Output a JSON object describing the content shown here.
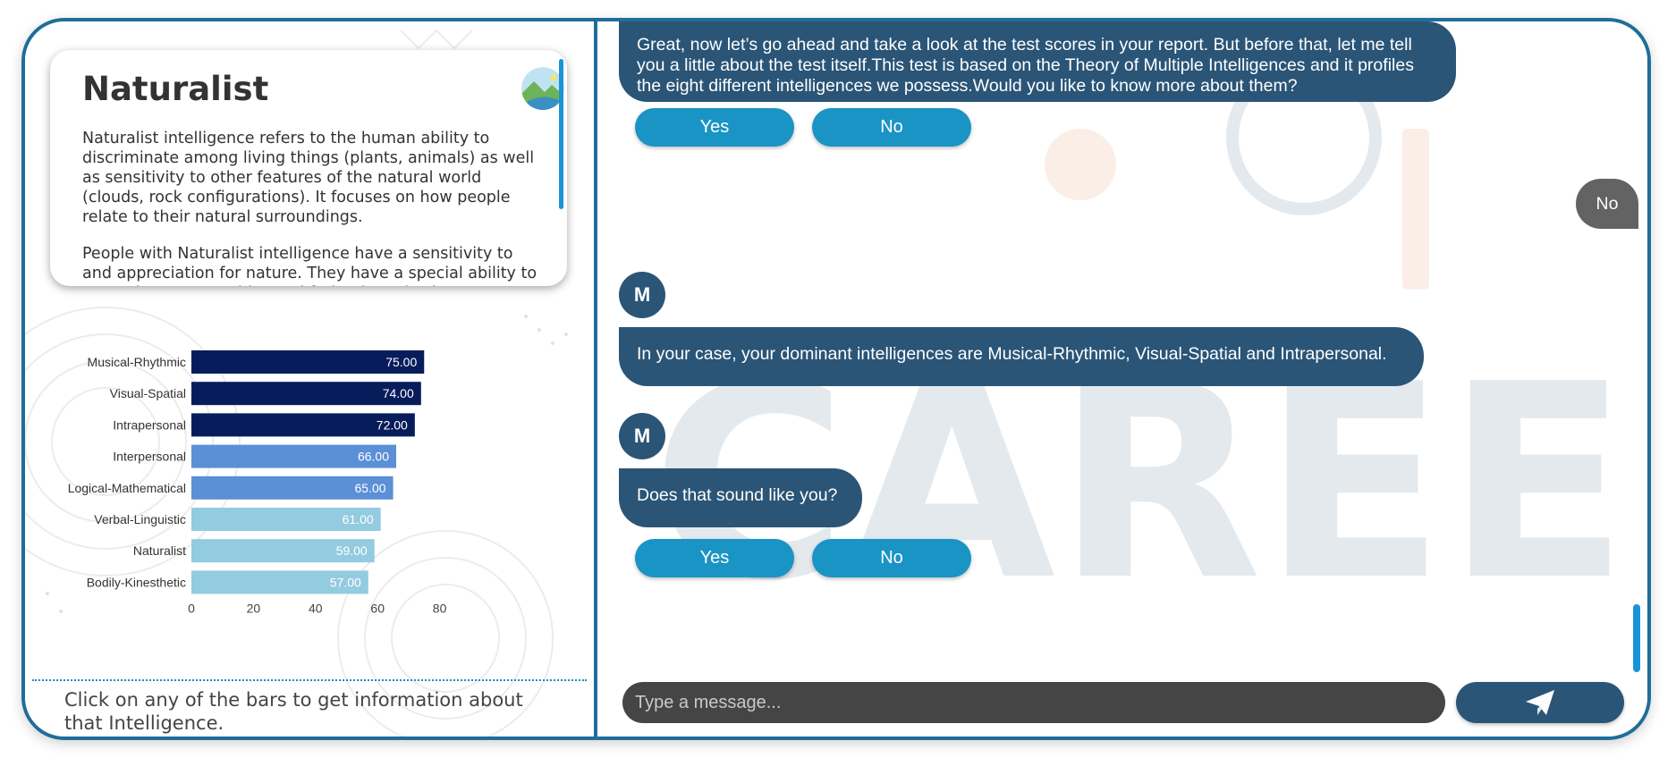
{
  "info_card": {
    "title": "Naturalist",
    "icon": "landscape-icon",
    "paragraphs": [
      "Naturalist intelligence refers to the human ability to discriminate among living things (plants, animals) as well as sensitivity to other features of the natural world (clouds, rock configurations). It focuses on how people relate to their natural surroundings.",
      "People with Naturalist intelligence have a sensitivity to and appreciation for nature. They have a special ability to grow plants, vegetables and fruit. They also have an affinity for"
    ]
  },
  "chart_data": {
    "type": "bar",
    "orientation": "horizontal",
    "categories": [
      "Musical-Rhythmic",
      "Visual-Spatial",
      "Intrapersonal",
      "Interpersonal",
      "Logical-Mathematical",
      "Verbal-Linguistic",
      "Naturalist",
      "Bodily-Kinesthetic"
    ],
    "values": [
      75,
      74,
      72,
      66,
      65,
      61,
      59,
      57
    ],
    "value_labels": [
      "75.00",
      "74.00",
      "72.00",
      "66.00",
      "65.00",
      "61.00",
      "59.00",
      "57.00"
    ],
    "colors": [
      "#071d5b",
      "#071d5b",
      "#071d5b",
      "#5b8fd6",
      "#5b8fd6",
      "#93cbe0",
      "#93cbe0",
      "#93cbe0"
    ],
    "x_ticks": [
      "0",
      "20",
      "40",
      "60",
      "80"
    ],
    "xlim": [
      0,
      90
    ],
    "grid": false,
    "title": "",
    "xlabel": "",
    "ylabel": ""
  },
  "chart_hint": "Click on any of the bars to get information about that Intelligence.",
  "chat": {
    "intro_message": "Great, now let’s go ahead and take a look at the test scores in your report. But before that, let me tell you a little about the test itself.This test is based on the Theory of Multiple Intelligences and it profiles the eight different intelligences we possess.Would you like to know more about them?",
    "yes_label": "Yes",
    "no_label": "No",
    "user_reply": "No",
    "avatar_letter": "M",
    "dominant_message": "In your case, your dominant intelligences are Musical-Rhythmic, Visual-Spatial and Intrapersonal.",
    "question_message": "Does that sound like you?",
    "input_placeholder": "Type a message...",
    "send_icon": "paper-plane-icon",
    "bot_bubble_color": "#2a5577",
    "button_color": "#1a94c4",
    "user_bubble_color": "#636363"
  }
}
